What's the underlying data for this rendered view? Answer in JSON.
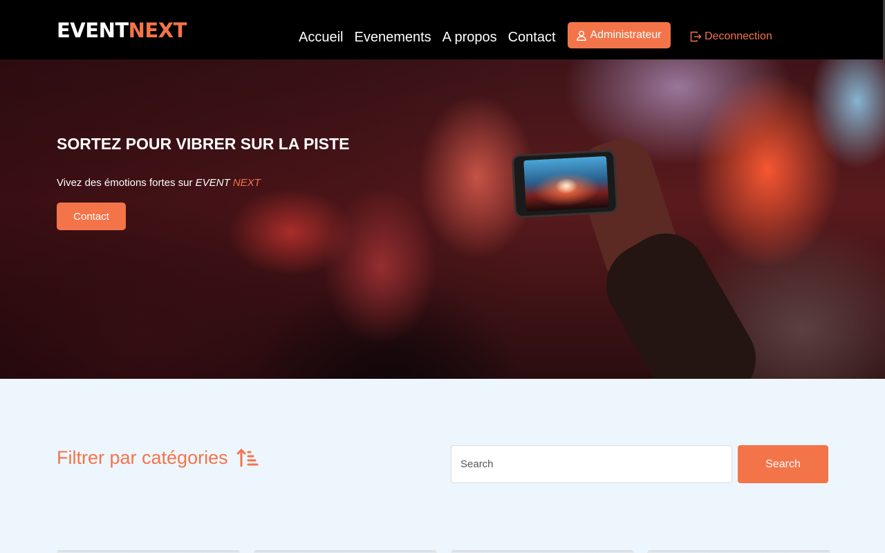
{
  "navbar": {
    "logo_part1": "EVENT",
    "logo_part2": "NEXT",
    "links": [
      "Accueil",
      "Evenements",
      "A propos",
      "Contact"
    ],
    "admin_label": "Administrateur",
    "logout_label": "Deconnection"
  },
  "hero": {
    "title": "SORTEZ POUR VIBRER SUR LA PISTE",
    "subtitle_prefix": "Vivez des émotions fortes sur ",
    "subtitle_brand1": "EVENT",
    "subtitle_brand2": "NEXT",
    "button_label": "Contact"
  },
  "filter": {
    "title": "Filtrer par catégories",
    "search_placeholder": "Search",
    "search_button": "Search"
  },
  "colors": {
    "accent": "#f4744a",
    "navbar_bg": "#000000",
    "page_bg": "#eef6fd"
  },
  "icons": {
    "admin": "user-icon",
    "logout": "logout-icon",
    "filter": "sort-ascending-icon"
  }
}
